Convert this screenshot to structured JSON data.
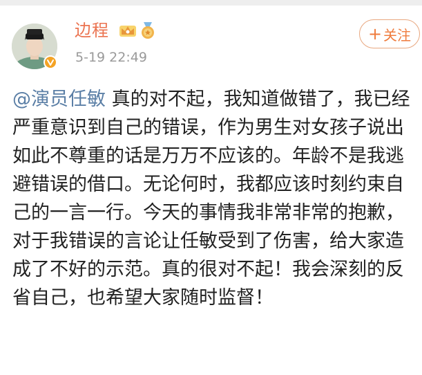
{
  "post": {
    "author": {
      "name": "边程"
    },
    "timestamp": "5-19 22:49",
    "follow_label": "关注",
    "follow_plus": "+",
    "mention": "@演员任敏",
    "text": " 真的对不起，我知道做错了，我已经严重意识到自己的错误，作为男生对女孩子说出如此不尊重的话是万万不应该的。年龄不是我逃避错误的借口。无论何时，我都应该时刻约束自己的一言一行。今天的事情我非常非常的抱歉，对于我错误的言论让任敏受到了伤害，给大家造成了不好的示范。真的很对不起！我会深刻的反省自己，也希望大家随时监督！"
  },
  "icons": {
    "avatar": "avatar-photo",
    "verified": "verified-v-icon",
    "crown": "crown-icon",
    "medal": "medal-icon"
  },
  "colors": {
    "username": "#eb7350",
    "mention": "#5b7fa6",
    "follow": "#ef7b3c",
    "verified": "#f4a325",
    "timestamp": "#9a9a9a"
  }
}
